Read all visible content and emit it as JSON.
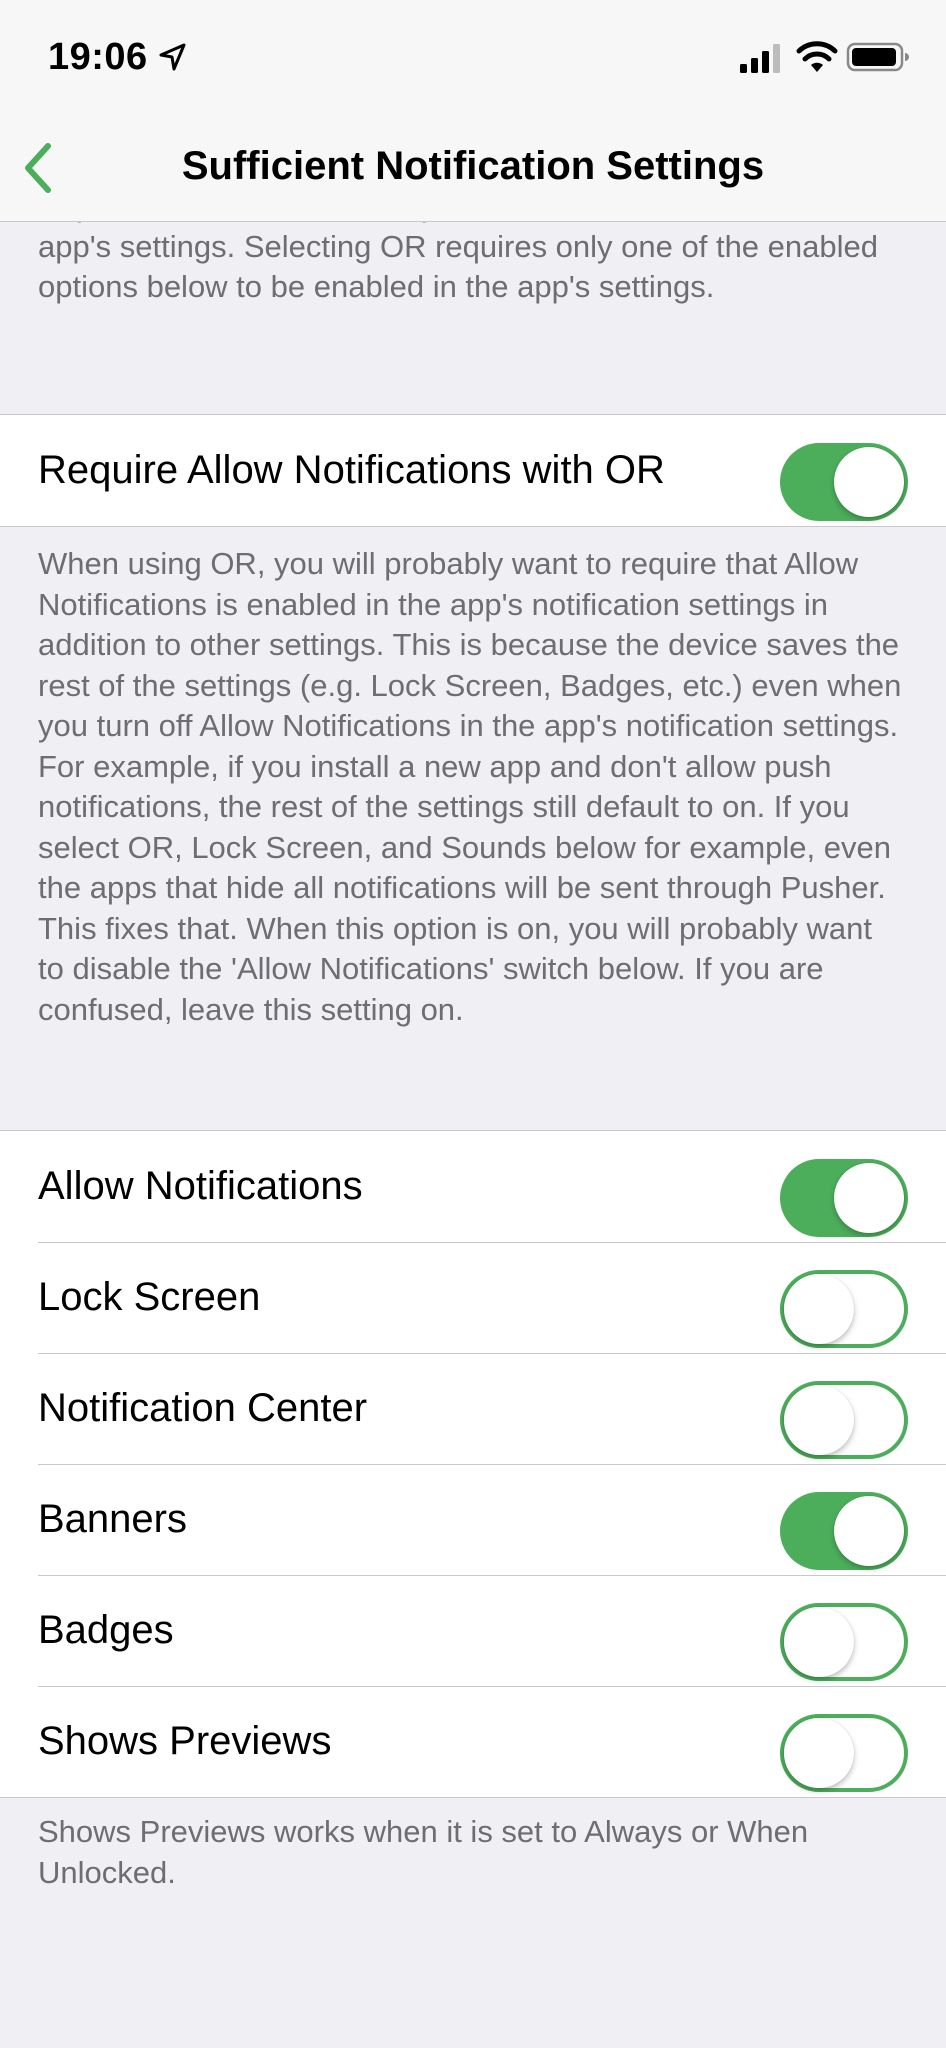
{
  "status_bar": {
    "time": "19:06"
  },
  "nav": {
    "title": "Sufficient Notification Settings",
    "back_icon": "chevron-left-icon"
  },
  "top_footer": "requires all of the enabled options below to be enabled in the app's settings. Selecting OR requires only one of the enabled options below to be enabled in the app's settings.",
  "require_group": {
    "label": "Require Allow Notifications with OR",
    "on": true
  },
  "require_footer": "When using OR, you will probably want to require that Allow Notifications is enabled in the app's notification settings in addition to other settings. This is because the device saves the rest of the settings (e.g. Lock Screen, Badges, etc.) even when you turn off Allow Notifications in the app's notification settings. For example, if you install a new app and don't allow push notifications, the rest of the settings still default to on. If you select OR, Lock Screen, and Sounds below for example, even the apps that hide all notifications will be sent through Pusher. This fixes that. When this option is on, you will probably want to disable the 'Allow Notifications' switch below. If you are confused, leave this setting on.",
  "settings": [
    {
      "label": "Allow Notifications",
      "on": true
    },
    {
      "label": "Lock Screen",
      "on": false
    },
    {
      "label": "Notification Center",
      "on": false
    },
    {
      "label": "Banners",
      "on": true
    },
    {
      "label": "Badges",
      "on": false
    },
    {
      "label": "Shows Previews",
      "on": false
    }
  ],
  "settings_footer": "Shows Previews works when it is set to Always or When Unlocked.",
  "colors": {
    "accent": "#4cae5b",
    "background": "#efeff4",
    "footer_text": "#6d6d72"
  }
}
